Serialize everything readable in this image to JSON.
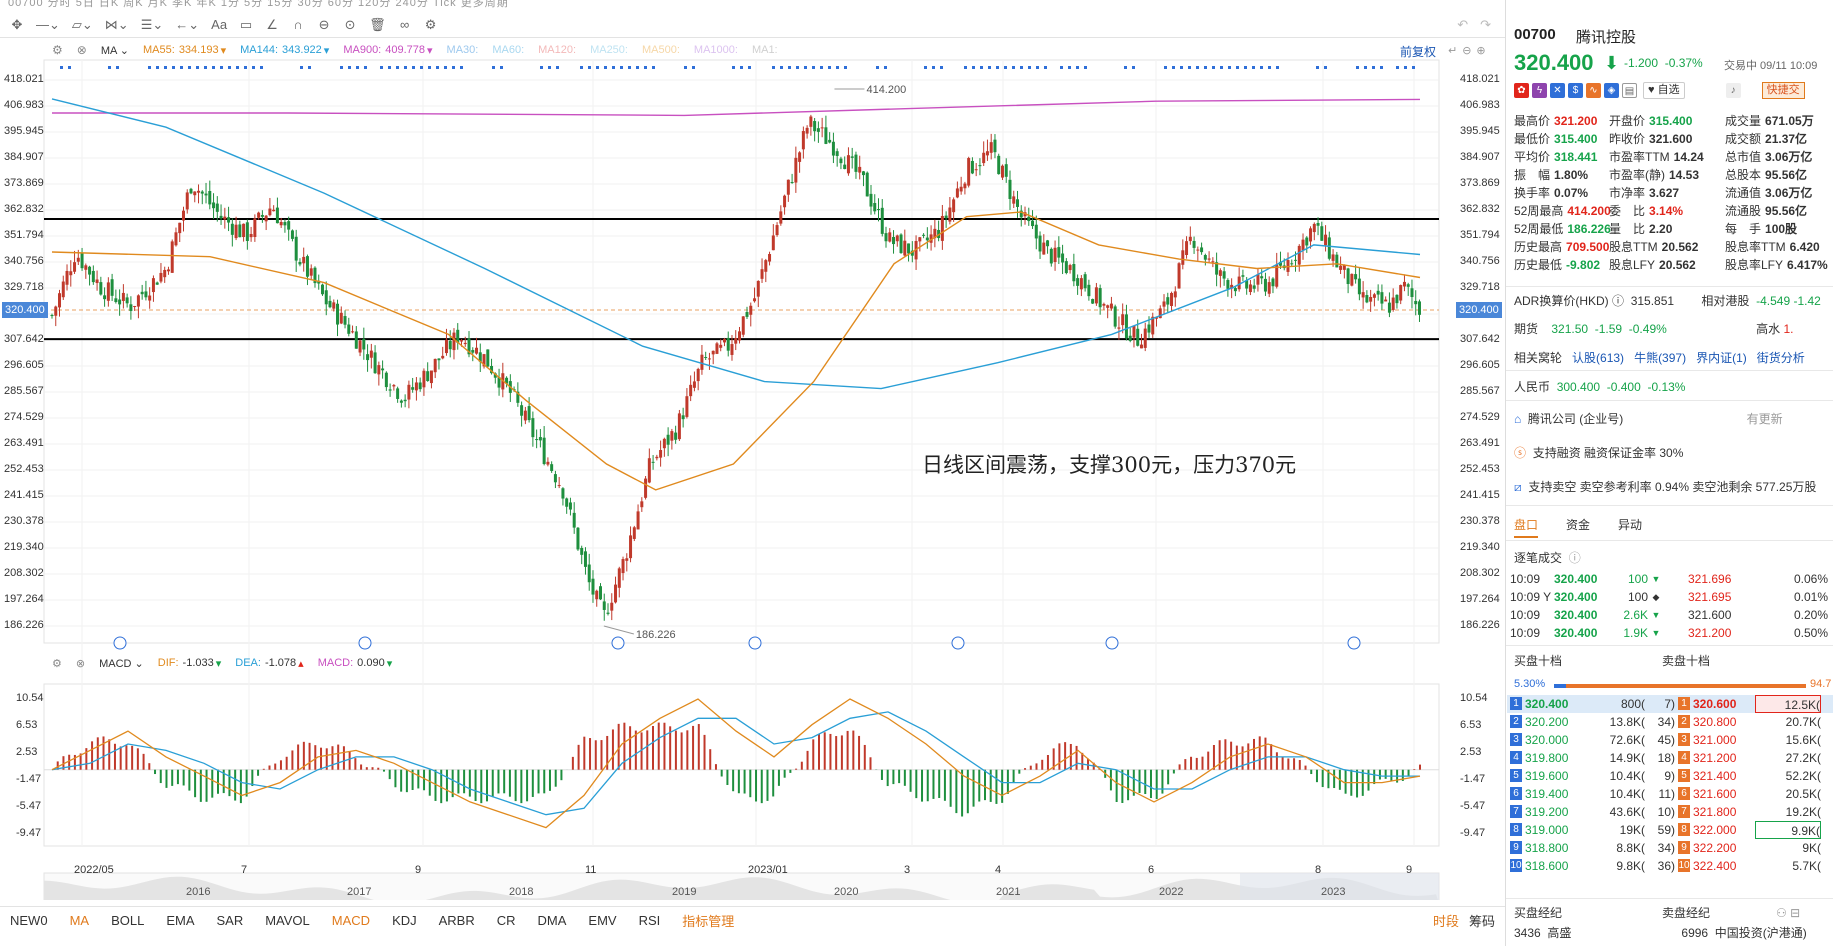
{
  "toolbar": {
    "top_strip": "00700  分时  5日  日K  周K  月K  季K  年K  1分  5分  15分  30分  60分  120分  240分  Tick  更多周期",
    "tool_icons": [
      "crosshair-icon",
      "line-icon",
      "rect-icon",
      "fib-icon",
      "channel-icon",
      "arrow-icon",
      "text-icon",
      "comment-icon",
      "pen-icon",
      "magnet-icon",
      "lock-icon",
      "eye-icon",
      "trash-icon",
      "link-icon",
      "gear-icon"
    ]
  },
  "ma_legend": {
    "ma_label": "MA",
    "items": [
      {
        "name": "MA55:",
        "value": "334.193",
        "color": "#e08a1e"
      },
      {
        "name": "MA144:",
        "value": "343.922",
        "color": "#2a9fd6"
      },
      {
        "name": "MA900:",
        "value": "409.778",
        "color": "#c850c0"
      },
      {
        "name": "MA30:",
        "value": "",
        "color": "#9ec9ee"
      },
      {
        "name": "MA60:",
        "value": "",
        "color": "#a9d8f0"
      },
      {
        "name": "MA120:",
        "value": "",
        "color": "#f3b9b9"
      },
      {
        "name": "MA250:",
        "value": "",
        "color": "#bfe3f2"
      },
      {
        "name": "MA500:",
        "value": "",
        "color": "#f6d7a7"
      },
      {
        "name": "MA1000:",
        "value": "",
        "color": "#dcc3f0"
      },
      {
        "name": "MA1:",
        "value": "",
        "color": "#d0d0d0"
      }
    ],
    "fuquan": "前复权"
  },
  "annotation": "日线区间震荡，支撑300元，压力370元",
  "macd_legend": {
    "label": "MACD",
    "items": [
      {
        "name": "DIF:",
        "value": "-1.033",
        "color": "#e08a1e"
      },
      {
        "name": "DEA:",
        "value": "-1.078",
        "color": "#2a9fd6"
      },
      {
        "name": "MACD:",
        "value": "0.090",
        "color": "#c850c0"
      }
    ]
  },
  "price_axis": [
    "418.021",
    "406.983",
    "395.945",
    "384.907",
    "373.869",
    "362.832",
    "351.794",
    "340.756",
    "329.718",
    "318.680",
    "307.642",
    "296.605",
    "285.567",
    "274.529",
    "263.491",
    "252.453",
    "241.415",
    "230.378",
    "219.340",
    "208.302",
    "197.264",
    "186.226"
  ],
  "current_price": "320.400",
  "macd_axis": [
    "10.54",
    "6.53",
    "2.53",
    "-1.47",
    "-5.47",
    "-9.47"
  ],
  "x_labels": [
    "2022/05",
    "7",
    "9",
    "11",
    "2023/01",
    "3",
    "4",
    "6",
    "8",
    "9"
  ],
  "years": [
    "2016",
    "2017",
    "2018",
    "2019",
    "2020",
    "2021",
    "2022",
    "2023"
  ],
  "bottom_tabs": [
    "NEW0",
    "MA",
    "BOLL",
    "EMA",
    "SAR",
    "MAVOL",
    "MACD",
    "KDJ",
    "ARBR",
    "CR",
    "DMA",
    "EMV",
    "RSI",
    "指标管理"
  ],
  "bottom_right": [
    "时段",
    "筹码"
  ],
  "chart_data": {
    "type": "candlestick",
    "title": "",
    "high_label": "414.200",
    "low_label": "186.226",
    "support_line": 308,
    "resistance_line": 359,
    "ylim": [
      186.226,
      418.021
    ],
    "close_path": [
      {
        "x": "2022/04/01",
        "y": 318
      },
      {
        "x": "2022/04/10",
        "y": 345
      },
      {
        "x": "2022/04/20",
        "y": 330
      },
      {
        "x": "2022/05/01",
        "y": 322
      },
      {
        "x": "2022/05/15",
        "y": 338
      },
      {
        "x": "2022/05/25",
        "y": 375
      },
      {
        "x": "2022/06/05",
        "y": 360
      },
      {
        "x": "2022/06/15",
        "y": 352
      },
      {
        "x": "2022/06/25",
        "y": 365
      },
      {
        "x": "2022/07/05",
        "y": 343
      },
      {
        "x": "2022/07/15",
        "y": 325
      },
      {
        "x": "2022/07/25",
        "y": 312
      },
      {
        "x": "2022/08/05",
        "y": 296
      },
      {
        "x": "2022/08/15",
        "y": 283
      },
      {
        "x": "2022/08/25",
        "y": 295
      },
      {
        "x": "2022/09/05",
        "y": 310
      },
      {
        "x": "2022/09/15",
        "y": 300
      },
      {
        "x": "2022/09/25",
        "y": 285
      },
      {
        "x": "2022/10/05",
        "y": 265
      },
      {
        "x": "2022/10/15",
        "y": 245
      },
      {
        "x": "2022/10/25",
        "y": 205
      },
      {
        "x": "2022/10/31",
        "y": 190
      },
      {
        "x": "2022/11/08",
        "y": 215
      },
      {
        "x": "2022/11/18",
        "y": 255
      },
      {
        "x": "2022/11/28",
        "y": 270
      },
      {
        "x": "2022/12/08",
        "y": 298
      },
      {
        "x": "2022/12/18",
        "y": 305
      },
      {
        "x": "2022/12/28",
        "y": 325
      },
      {
        "x": "2023/01/08",
        "y": 365
      },
      {
        "x": "2023/01/18",
        "y": 400
      },
      {
        "x": "2023/01/28",
        "y": 390
      },
      {
        "x": "2023/02/08",
        "y": 375
      },
      {
        "x": "2023/02/18",
        "y": 350
      },
      {
        "x": "2023/02/28",
        "y": 345
      },
      {
        "x": "2023/03/10",
        "y": 355
      },
      {
        "x": "2023/03/20",
        "y": 380
      },
      {
        "x": "2023/03/30",
        "y": 388
      },
      {
        "x": "2023/04/10",
        "y": 360
      },
      {
        "x": "2023/04/20",
        "y": 345
      },
      {
        "x": "2023/05/01",
        "y": 336
      },
      {
        "x": "2023/05/12",
        "y": 322
      },
      {
        "x": "2023/05/25",
        "y": 308
      },
      {
        "x": "2023/06/05",
        "y": 322
      },
      {
        "x": "2023/06/15",
        "y": 352
      },
      {
        "x": "2023/06/25",
        "y": 335
      },
      {
        "x": "2023/07/05",
        "y": 330
      },
      {
        "x": "2023/07/15",
        "y": 332
      },
      {
        "x": "2023/07/25",
        "y": 345
      },
      {
        "x": "2023/08/01",
        "y": 356
      },
      {
        "x": "2023/08/10",
        "y": 340
      },
      {
        "x": "2023/08/20",
        "y": 325
      },
      {
        "x": "2023/08/30",
        "y": 322
      },
      {
        "x": "2023/09/05",
        "y": 330
      },
      {
        "x": "2023/09/11",
        "y": 320.4
      }
    ],
    "ma55": [
      {
        "x": "2022/04/01",
        "y": 345
      },
      {
        "x": "2022/06/01",
        "y": 343
      },
      {
        "x": "2022/07/15",
        "y": 332
      },
      {
        "x": "2022/09/01",
        "y": 310
      },
      {
        "x": "2022/10/01",
        "y": 282
      },
      {
        "x": "2022/11/01",
        "y": 255
      },
      {
        "x": "2022/11/20",
        "y": 244
      },
      {
        "x": "2022/12/20",
        "y": 255
      },
      {
        "x": "2023/01/20",
        "y": 290
      },
      {
        "x": "2023/02/20",
        "y": 340
      },
      {
        "x": "2023/03/20",
        "y": 360
      },
      {
        "x": "2023/04/10",
        "y": 362
      },
      {
        "x": "2023/05/10",
        "y": 348
      },
      {
        "x": "2023/06/10",
        "y": 342
      },
      {
        "x": "2023/07/10",
        "y": 338
      },
      {
        "x": "2023/08/10",
        "y": 340
      },
      {
        "x": "2023/09/11",
        "y": 334.193
      }
    ],
    "ma144": [
      {
        "x": "2022/04/01",
        "y": 410
      },
      {
        "x": "2022/05/15",
        "y": 398
      },
      {
        "x": "2022/07/15",
        "y": 370
      },
      {
        "x": "2022/09/15",
        "y": 338
      },
      {
        "x": "2022/11/15",
        "y": 305
      },
      {
        "x": "2023/01/01",
        "y": 290
      },
      {
        "x": "2023/02/15",
        "y": 287
      },
      {
        "x": "2023/04/01",
        "y": 298
      },
      {
        "x": "2023/05/15",
        "y": 310
      },
      {
        "x": "2023/07/01",
        "y": 330
      },
      {
        "x": "2023/08/01",
        "y": 348
      },
      {
        "x": "2023/09/11",
        "y": 343.922
      }
    ],
    "ma900": [
      {
        "x": "2022/04/01",
        "y": 404
      },
      {
        "x": "2022/07/01",
        "y": 404
      },
      {
        "x": "2022/12/01",
        "y": 403
      },
      {
        "x": "2023/03/01",
        "y": 406
      },
      {
        "x": "2023/06/01",
        "y": 409
      },
      {
        "x": "2023/09/11",
        "y": 409.778
      }
    ],
    "macd": {
      "dif": [
        0,
        3,
        6,
        2,
        -1,
        -4,
        -2,
        2,
        3,
        1,
        -2,
        -5,
        -7,
        -9,
        -4,
        4,
        8,
        11,
        6,
        2,
        7,
        11,
        8,
        4,
        -1,
        -4,
        -1,
        3,
        -2,
        -5,
        -2,
        2,
        4,
        2,
        -2,
        -2,
        -1
      ],
      "dea": [
        0,
        1,
        4,
        3,
        1,
        -2,
        -3,
        0,
        2,
        2,
        0,
        -3,
        -5,
        -7,
        -6,
        1,
        5,
        8,
        8,
        4,
        5,
        8,
        9,
        6,
        2,
        -2,
        -2,
        1,
        0,
        -3,
        -3,
        0,
        2,
        2,
        0,
        -1,
        -1
      ],
      "ylim": [
        -10,
        11
      ]
    }
  },
  "panel": {
    "code": "00700",
    "name": "腾讯控股",
    "price": "320.400",
    "change": "-1.200",
    "change_pct": "-0.37%",
    "status": "交易中 09/11 10:09",
    "self_select": "自选",
    "quick_trade": "快捷交",
    "quote_rows": [
      [
        {
          "k": "最高价",
          "v": "321.200",
          "c": "up"
        },
        {
          "k": "开盘价",
          "v": "315.400",
          "c": "down"
        },
        {
          "k": "成交量",
          "v": "671.05万",
          "c": "nc"
        }
      ],
      [
        {
          "k": "最低价",
          "v": "315.400",
          "c": "down"
        },
        {
          "k": "昨收价",
          "v": "321.600",
          "c": "nc"
        },
        {
          "k": "成交额",
          "v": "21.37亿",
          "c": "nc"
        }
      ],
      [
        {
          "k": "平均价",
          "v": "318.441",
          "c": "down"
        },
        {
          "k": "市盈率TTM",
          "v": "14.24",
          "c": "nc"
        },
        {
          "k": "总市值",
          "v": "3.06万亿",
          "c": "nc"
        }
      ],
      [
        {
          "k": "振　幅",
          "v": "1.80%",
          "c": "nc"
        },
        {
          "k": "市盈率(静)",
          "v": "14.53",
          "c": "nc"
        },
        {
          "k": "总股本",
          "v": "95.56亿",
          "c": "nc"
        }
      ],
      [
        {
          "k": "换手率",
          "v": "0.07%",
          "c": "nc"
        },
        {
          "k": "市净率",
          "v": "3.627",
          "c": "nc"
        },
        {
          "k": "流通值",
          "v": "3.06万亿",
          "c": "nc"
        }
      ],
      [
        {
          "k": "52周最高",
          "v": "414.200",
          "c": "up"
        },
        {
          "k": "委　比",
          "v": "3.14%",
          "c": "up"
        },
        {
          "k": "流通股",
          "v": "95.56亿",
          "c": "nc"
        }
      ],
      [
        {
          "k": "52周最低",
          "v": "186.226",
          "c": "down"
        },
        {
          "k": "量　比",
          "v": "2.20",
          "c": "nc"
        },
        {
          "k": "每　手",
          "v": "100股",
          "c": "nc"
        }
      ],
      [
        {
          "k": "历史最高",
          "v": "709.500",
          "c": "up"
        },
        {
          "k": "股息TTM",
          "v": "20.562",
          "c": "nc"
        },
        {
          "k": "股息率TTM",
          "v": "6.420",
          "c": "nc"
        }
      ],
      [
        {
          "k": "历史最低",
          "v": "-9.802",
          "c": "down"
        },
        {
          "k": "股息LFY",
          "v": "20.562",
          "c": "nc"
        },
        {
          "k": "股息率LFY",
          "v": "6.417%",
          "c": "nc"
        }
      ]
    ],
    "adr": {
      "label": "ADR换算价(HKD)",
      "value": "315.851",
      "rel_label": "相对港股",
      "rel_value": "-4.549 -1.42"
    },
    "futures": {
      "label": "期货",
      "value": "321.50",
      "chg": "-1.59",
      "pct": "-0.49%",
      "right": "高水",
      "right_v": "1."
    },
    "warrants": {
      "label": "相关窝轮",
      "items": [
        "认股(613)",
        "牛熊(397)",
        "界内证(1)",
        "街货分析"
      ]
    },
    "rmb": {
      "label": "人民币",
      "value": "300.400",
      "chg": "-0.400",
      "pct": "-0.13%"
    },
    "company": {
      "text": "腾讯公司 (企业号)",
      "right": "有更新"
    },
    "margin": "支持融资 融资保证金率 30%",
    "short": "支持卖空 卖空参考利率 0.94% 卖空池剩余 577.25万股",
    "tabs": [
      "盘口",
      "资金",
      "异动"
    ],
    "tick_title": "逐笔成交",
    "ticks": [
      {
        "t": "10:09",
        "p": "320.400",
        "v": "100",
        "pc": "down",
        "vc": "down",
        "mark": "▼",
        "r": "321.696",
        "rp": "0.06%",
        "rc": "up"
      },
      {
        "t": "10:09 Y",
        "p": "320.400",
        "v": "100",
        "pc": "down",
        "vc": "nc",
        "mark": "◆",
        "r": "321.695",
        "rp": "0.01%",
        "rc": "up"
      },
      {
        "t": "10:09",
        "p": "320.400",
        "v": "2.6K",
        "pc": "down",
        "vc": "down",
        "mark": "▼",
        "r": "321.600",
        "rp": "0.20%",
        "rc": "nc"
      },
      {
        "t": "10:09",
        "p": "320.400",
        "v": "1.9K",
        "pc": "down",
        "vc": "down",
        "mark": "▼",
        "r": "321.200",
        "rp": "0.50%",
        "rc": "up"
      }
    ],
    "ob_titles": [
      "买盘十档",
      "卖盘十档"
    ],
    "ratio_left": "5.30%",
    "ratio_right": "94.7",
    "bids": [
      {
        "i": "1",
        "p": "320.400",
        "q": "800(",
        "n": "7)"
      },
      {
        "i": "2",
        "p": "320.200",
        "q": "13.8K(",
        "n": "34)"
      },
      {
        "i": "3",
        "p": "320.000",
        "q": "72.6K(",
        "n": "45)"
      },
      {
        "i": "4",
        "p": "319.800",
        "q": "14.9K(",
        "n": "18)"
      },
      {
        "i": "5",
        "p": "319.600",
        "q": "10.4K(",
        "n": "9)"
      },
      {
        "i": "6",
        "p": "319.400",
        "q": "10.4K(",
        "n": "11)"
      },
      {
        "i": "7",
        "p": "319.200",
        "q": "43.6K(",
        "n": "10)"
      },
      {
        "i": "8",
        "p": "319.000",
        "q": "19K(",
        "n": "59)"
      },
      {
        "i": "9",
        "p": "318.800",
        "q": "8.8K(",
        "n": "34)"
      },
      {
        "i": "10",
        "p": "318.600",
        "q": "9.8K(",
        "n": "36)"
      }
    ],
    "asks": [
      {
        "i": "1",
        "p": "320.600",
        "q": "12.5K("
      },
      {
        "i": "2",
        "p": "320.800",
        "q": "20.7K("
      },
      {
        "i": "3",
        "p": "321.000",
        "q": "15.6K("
      },
      {
        "i": "4",
        "p": "321.200",
        "q": "27.2K("
      },
      {
        "i": "5",
        "p": "321.400",
        "q": "52.2K("
      },
      {
        "i": "6",
        "p": "321.600",
        "q": "20.5K("
      },
      {
        "i": "7",
        "p": "321.800",
        "q": "19.2K("
      },
      {
        "i": "8",
        "p": "322.000",
        "q": "9.9K("
      },
      {
        "i": "9",
        "p": "322.200",
        "q": "9K("
      },
      {
        "i": "10",
        "p": "322.400",
        "q": "5.7K("
      }
    ],
    "brokers_title": [
      "买盘经纪",
      "卖盘经纪"
    ],
    "broker_left": {
      "id": "3436",
      "name": "高盛"
    },
    "broker_right": {
      "id": "6996",
      "name": "中国投资(沪港通)"
    }
  }
}
